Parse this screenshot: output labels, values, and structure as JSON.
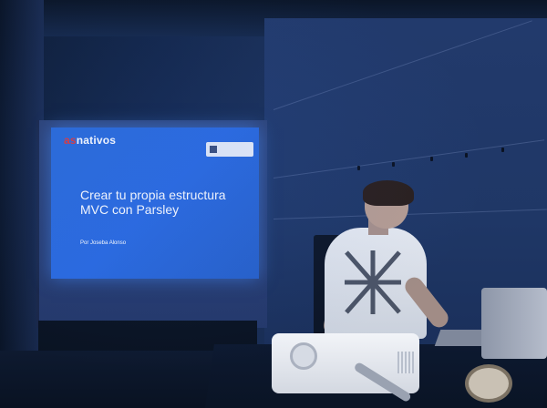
{
  "slide": {
    "logo_prefix": "as",
    "logo_suffix": "nativos",
    "title": "Crear tu propia estructura MVC con Parsley",
    "author": "Por Joseba Alonso"
  },
  "colors": {
    "projection_blue": "#2a6ae0",
    "logo_accent": "#e23a3a",
    "room_dark": "#0d1a30"
  }
}
